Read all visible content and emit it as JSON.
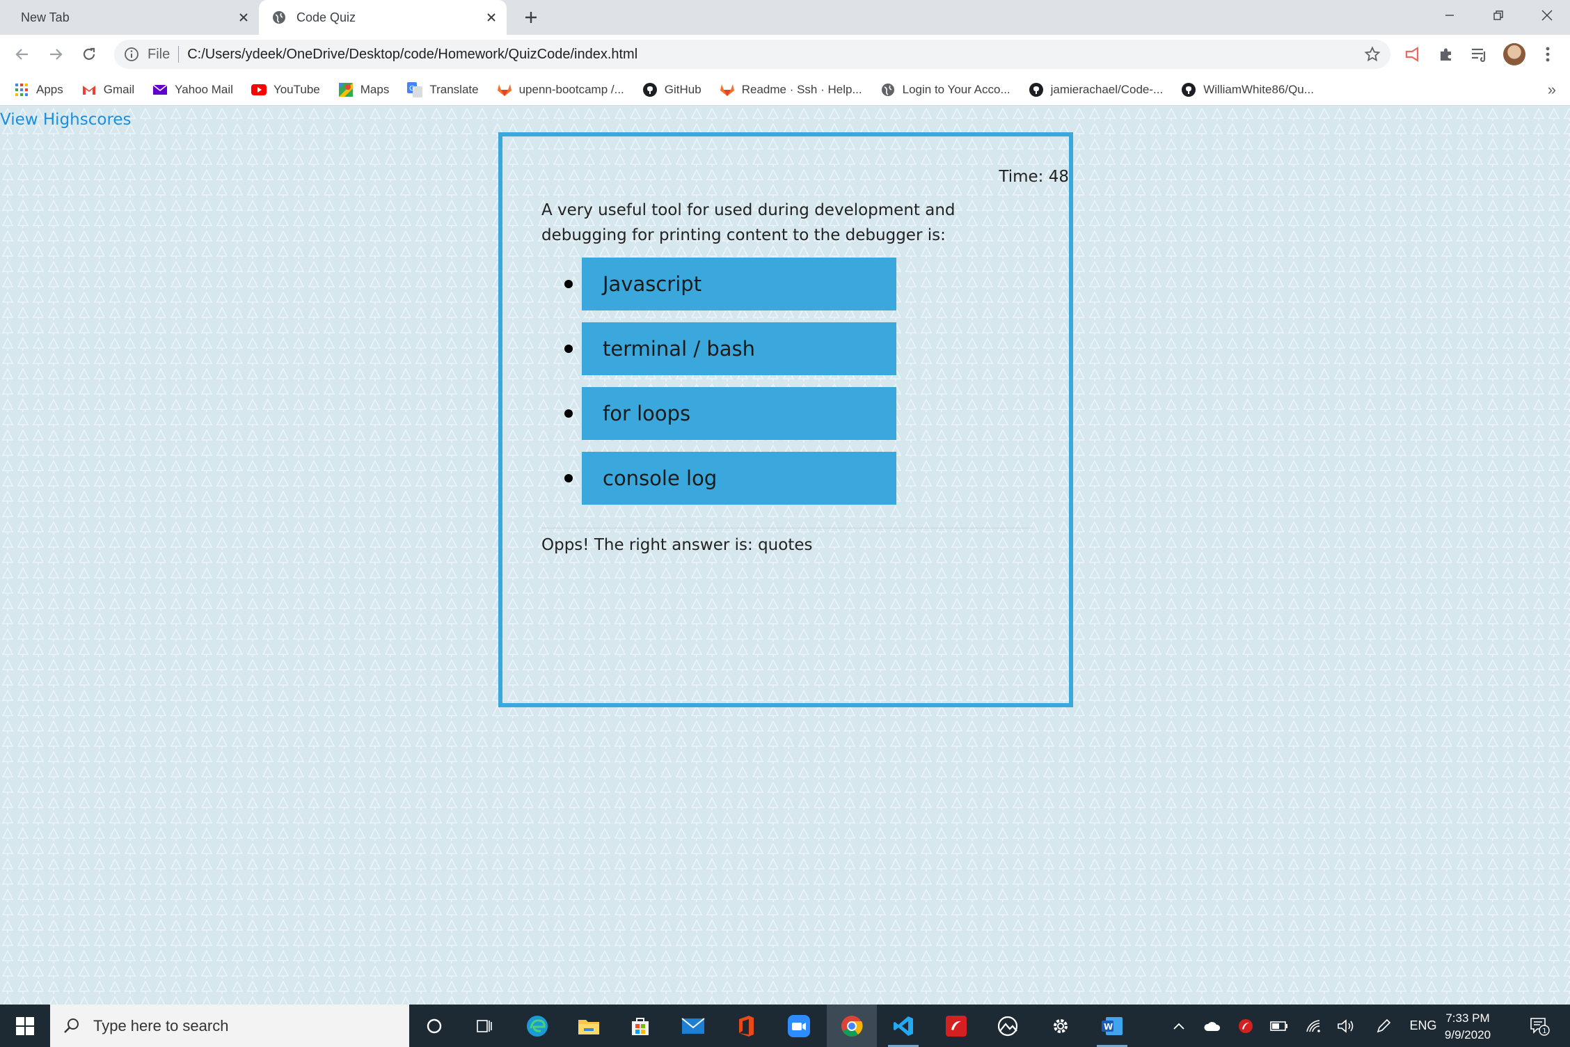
{
  "browser": {
    "tabs": [
      {
        "title": "New Tab",
        "active": false
      },
      {
        "title": "Code Quiz",
        "active": true
      }
    ],
    "address": {
      "scheme_label": "File",
      "url": "C:/Users/ydeek/OneDrive/Desktop/code/Homework/QuizCode/index.html"
    },
    "bookmarks": [
      {
        "label": "Apps",
        "icon": "apps-grid-icon"
      },
      {
        "label": "Gmail",
        "icon": "gmail-icon"
      },
      {
        "label": "Yahoo Mail",
        "icon": "yahoo-mail-icon"
      },
      {
        "label": "YouTube",
        "icon": "youtube-icon"
      },
      {
        "label": "Maps",
        "icon": "maps-icon"
      },
      {
        "label": "Translate",
        "icon": "translate-icon"
      },
      {
        "label": "upenn-bootcamp /...",
        "icon": "gitlab-icon"
      },
      {
        "label": "GitHub",
        "icon": "github-icon"
      },
      {
        "label": "Readme · Ssh · Help...",
        "icon": "gitlab-icon"
      },
      {
        "label": "Login to Your Acco...",
        "icon": "globe-icon"
      },
      {
        "label": "jamierachael/Code-...",
        "icon": "github-icon"
      },
      {
        "label": "WilliamWhite86/Qu...",
        "icon": "github-icon"
      }
    ],
    "bookmarks_overflow": "»"
  },
  "page": {
    "view_highscores": "View Highscores",
    "timer": "Time: 48",
    "question": "A very useful tool for used during development and debugging for printing content to the debugger is:",
    "choices": [
      "Javascript",
      "terminal / bash",
      "for loops",
      "console log"
    ],
    "feedback": "Opps! The right answer is: quotes",
    "colors": {
      "accent": "#3aa8dd",
      "link": "#1a8fe0",
      "background": "#d7e7ee"
    }
  },
  "taskbar": {
    "search_placeholder": "Type here to search",
    "apps": [
      "cortana-icon",
      "task-view-icon",
      "edge-icon",
      "file-explorer-icon",
      "store-icon",
      "mail-icon",
      "office-icon",
      "zoom-icon",
      "chrome-icon",
      "vscode-icon",
      "antivirus-icon",
      "photos-icon",
      "settings-icon",
      "word-icon"
    ],
    "language": "ENG",
    "time": "7:33 PM",
    "date": "9/9/2020",
    "notification_count": "1"
  }
}
